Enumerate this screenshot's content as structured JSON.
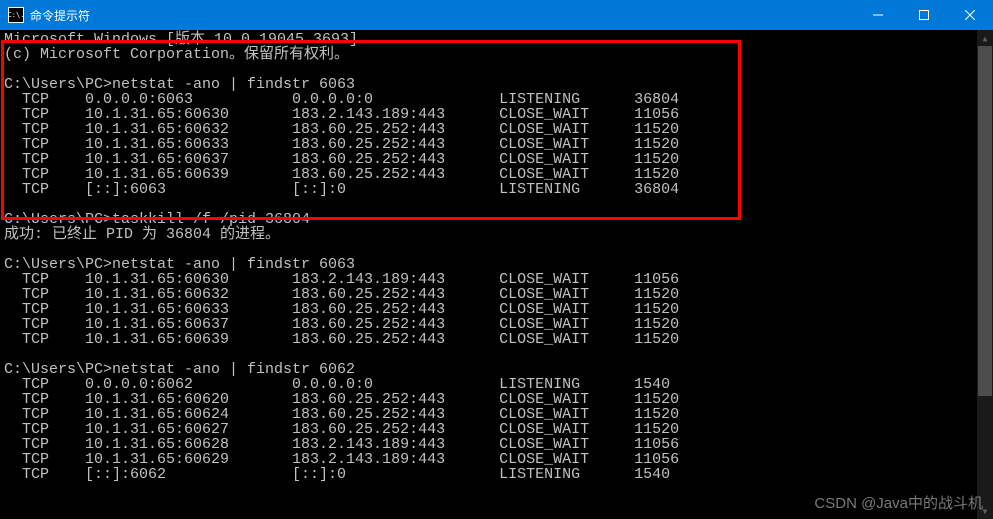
{
  "titlebar": {
    "icon_text": "C:\\.",
    "title": "命令提示符"
  },
  "terminal": {
    "header_line1": "Microsoft Windows [版本 10.0.19045.3693]",
    "header_line2": "(c) Microsoft Corporation。保留所有权利。",
    "blocks": [
      {
        "prompt": "C:\\Users\\PC>",
        "command": "netstat -ano | findstr 6063",
        "rows": [
          {
            "proto": "TCP",
            "local": "0.0.0.0:6063",
            "foreign": "0.0.0.0:0",
            "state": "LISTENING",
            "pid": "36804"
          },
          {
            "proto": "TCP",
            "local": "10.1.31.65:60630",
            "foreign": "183.2.143.189:443",
            "state": "CLOSE_WAIT",
            "pid": "11056"
          },
          {
            "proto": "TCP",
            "local": "10.1.31.65:60632",
            "foreign": "183.60.25.252:443",
            "state": "CLOSE_WAIT",
            "pid": "11520"
          },
          {
            "proto": "TCP",
            "local": "10.1.31.65:60633",
            "foreign": "183.60.25.252:443",
            "state": "CLOSE_WAIT",
            "pid": "11520"
          },
          {
            "proto": "TCP",
            "local": "10.1.31.65:60637",
            "foreign": "183.60.25.252:443",
            "state": "CLOSE_WAIT",
            "pid": "11520"
          },
          {
            "proto": "TCP",
            "local": "10.1.31.65:60639",
            "foreign": "183.60.25.252:443",
            "state": "CLOSE_WAIT",
            "pid": "11520"
          },
          {
            "proto": "TCP",
            "local": "[::]:6063",
            "foreign": "[::]:0",
            "state": "LISTENING",
            "pid": "36804"
          }
        ]
      },
      {
        "prompt": "C:\\Users\\PC>",
        "command": "taskkill /f /pid 36804",
        "result": "成功: 已终止 PID 为 36804 的进程。"
      },
      {
        "prompt": "C:\\Users\\PC>",
        "command": "netstat -ano | findstr 6063",
        "rows": [
          {
            "proto": "TCP",
            "local": "10.1.31.65:60630",
            "foreign": "183.2.143.189:443",
            "state": "CLOSE_WAIT",
            "pid": "11056"
          },
          {
            "proto": "TCP",
            "local": "10.1.31.65:60632",
            "foreign": "183.60.25.252:443",
            "state": "CLOSE_WAIT",
            "pid": "11520"
          },
          {
            "proto": "TCP",
            "local": "10.1.31.65:60633",
            "foreign": "183.60.25.252:443",
            "state": "CLOSE_WAIT",
            "pid": "11520"
          },
          {
            "proto": "TCP",
            "local": "10.1.31.65:60637",
            "foreign": "183.60.25.252:443",
            "state": "CLOSE_WAIT",
            "pid": "11520"
          },
          {
            "proto": "TCP",
            "local": "10.1.31.65:60639",
            "foreign": "183.60.25.252:443",
            "state": "CLOSE_WAIT",
            "pid": "11520"
          }
        ]
      },
      {
        "prompt": "C:\\Users\\PC>",
        "command": "netstat -ano | findstr 6062",
        "rows": [
          {
            "proto": "TCP",
            "local": "0.0.0.0:6062",
            "foreign": "0.0.0.0:0",
            "state": "LISTENING",
            "pid": "1540"
          },
          {
            "proto": "TCP",
            "local": "10.1.31.65:60620",
            "foreign": "183.60.25.252:443",
            "state": "CLOSE_WAIT",
            "pid": "11520"
          },
          {
            "proto": "TCP",
            "local": "10.1.31.65:60624",
            "foreign": "183.60.25.252:443",
            "state": "CLOSE_WAIT",
            "pid": "11520"
          },
          {
            "proto": "TCP",
            "local": "10.1.31.65:60627",
            "foreign": "183.60.25.252:443",
            "state": "CLOSE_WAIT",
            "pid": "11520"
          },
          {
            "proto": "TCP",
            "local": "10.1.31.65:60628",
            "foreign": "183.2.143.189:443",
            "state": "CLOSE_WAIT",
            "pid": "11056"
          },
          {
            "proto": "TCP",
            "local": "10.1.31.65:60629",
            "foreign": "183.2.143.189:443",
            "state": "CLOSE_WAIT",
            "pid": "11056"
          },
          {
            "proto": "TCP",
            "local": "[::]:6062",
            "foreign": "[::]:0",
            "state": "LISTENING",
            "pid": "1540"
          }
        ]
      }
    ]
  },
  "watermark": "CSDN @Java中的战斗机"
}
